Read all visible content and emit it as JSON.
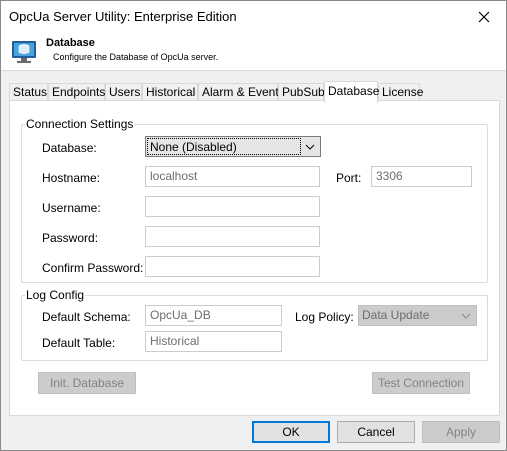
{
  "window": {
    "title": "OpcUa Server Utility: Enterprise Edition"
  },
  "header": {
    "title": "Database",
    "subtitle": "Configure the Database of OpcUa server."
  },
  "tabs": [
    {
      "label": "Status"
    },
    {
      "label": "Endpoints"
    },
    {
      "label": "Users"
    },
    {
      "label": "Historical"
    },
    {
      "label": "Alarm & Event"
    },
    {
      "label": "PubSub"
    },
    {
      "label": "Database"
    },
    {
      "label": "License"
    }
  ],
  "connection": {
    "group_label": "Connection Settings",
    "database_label": "Database:",
    "database_value": "None (Disabled)",
    "hostname_label": "Hostname:",
    "hostname_value": "localhost",
    "port_label": "Port:",
    "port_value": "3306",
    "username_label": "Username:",
    "username_value": "",
    "password_label": "Password:",
    "password_value": "",
    "confirm_label": "Confirm Password:",
    "confirm_value": ""
  },
  "log": {
    "group_label": "Log Config",
    "schema_label": "Default Schema:",
    "schema_value": "OpcUa_DB",
    "policy_label": "Log Policy:",
    "policy_value": "Data Update",
    "table_label": "Default Table:",
    "table_value": "Historical"
  },
  "actions": {
    "init_label": "Init. Database",
    "test_label": "Test Connection"
  },
  "footer": {
    "ok_label": "OK",
    "cancel_label": "Cancel",
    "apply_label": "Apply"
  },
  "colors": {
    "accent": "#0078d7",
    "selected_tab_bg": "#ffffff"
  }
}
